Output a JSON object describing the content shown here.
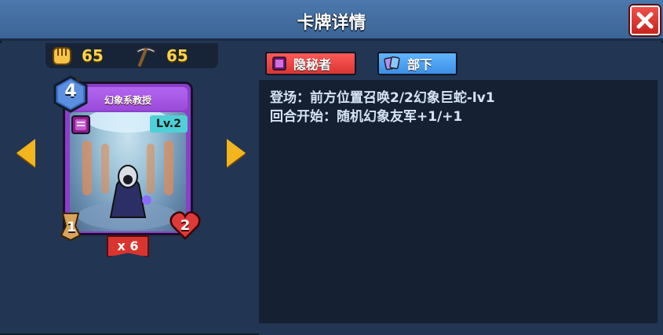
{
  "header": {
    "title": "卡牌详情"
  },
  "resources": [
    {
      "icon": "fist-icon",
      "value": "65"
    },
    {
      "icon": "pickaxe-icon",
      "value": "65"
    }
  ],
  "card": {
    "name": "幻象系教授",
    "level": "Lv.2",
    "cost": "4",
    "attack": "1",
    "health": "2",
    "count": "x 6"
  },
  "tags": [
    {
      "label": "隐秘者",
      "icon": "book-icon"
    },
    {
      "label": "部下",
      "icon": "cards-icon"
    }
  ],
  "description": [
    "登场：前方位置召唤2/2幻象巨蛇-lv1",
    "回合开始：随机幻象友军+1/+1"
  ],
  "colors": {
    "accent_gold": "#ffd24a",
    "card_purple": "#8b3fc9",
    "tag_red": "#d83532",
    "tag_blue": "#3d8ee6"
  }
}
